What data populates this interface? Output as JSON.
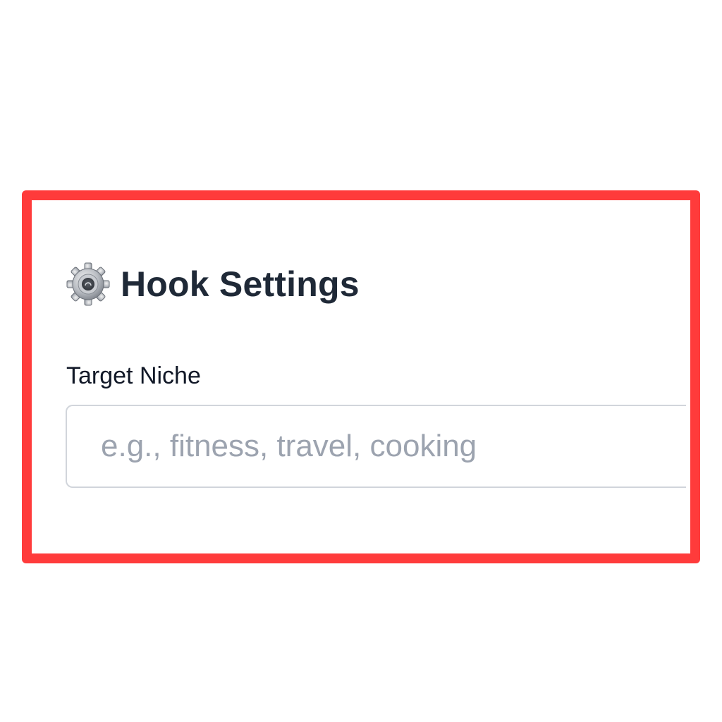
{
  "highlight": {
    "color": "#ff3b3b"
  },
  "panel": {
    "icon": "gear-icon",
    "title": "Hook Settings",
    "title_color": "#1f2937"
  },
  "fields": {
    "target_niche": {
      "label": "Target Niche",
      "value": "",
      "placeholder": "e.g., fitness, travel, cooking",
      "placeholder_color": "#9ca3af"
    }
  }
}
